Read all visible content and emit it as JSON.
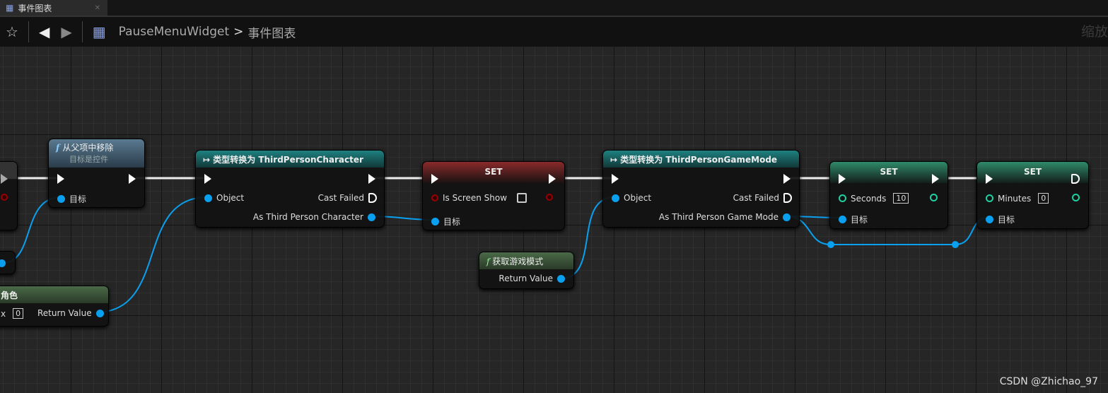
{
  "tab": {
    "label": "事件图表",
    "icon": "graph-icon"
  },
  "toolbar": {
    "breadcrumb_root": "PauseMenuWidget",
    "breadcrumb_sep": ">",
    "breadcrumb_leaf": "事件图表",
    "zoom_label": "缩放"
  },
  "nodes": {
    "remove": {
      "title": "从父项中移除",
      "subtitle": "目标是控件",
      "target": "目标"
    },
    "cast1": {
      "title": "类型转换为 ThirdPersonCharacter",
      "object": "Object",
      "failed": "Cast Failed",
      "out": "As Third Person Character"
    },
    "set1": {
      "title": "SET",
      "var": "Is Screen Show",
      "target": "目标"
    },
    "getmode": {
      "title": "获取游戏模式",
      "out": "Return Value"
    },
    "cast2": {
      "title": "类型转换为 ThirdPersonGameMode",
      "object": "Object",
      "failed": "Cast Failed",
      "out": "As Third Person Game Mode"
    },
    "set2": {
      "title": "SET",
      "var": "Seconds",
      "value": "10",
      "target": "目标"
    },
    "set3": {
      "title": "SET",
      "var": "Minutes",
      "value": "0",
      "target": "目标"
    },
    "getchar": {
      "title": "角色",
      "index_label": "x",
      "index": "0",
      "out": "Return Value"
    }
  },
  "colors": {
    "wire_object": "#0aa0f0",
    "int_pin": "#1fd0a0",
    "cast_header": "#1a6e6e",
    "set_header_bool": "#7a1e1e",
    "set_header_int": "#2a7a60",
    "func_header": "#3e5a70",
    "pure_header": "#3f5a3a"
  },
  "watermark": "CSDN @Zhichao_97"
}
